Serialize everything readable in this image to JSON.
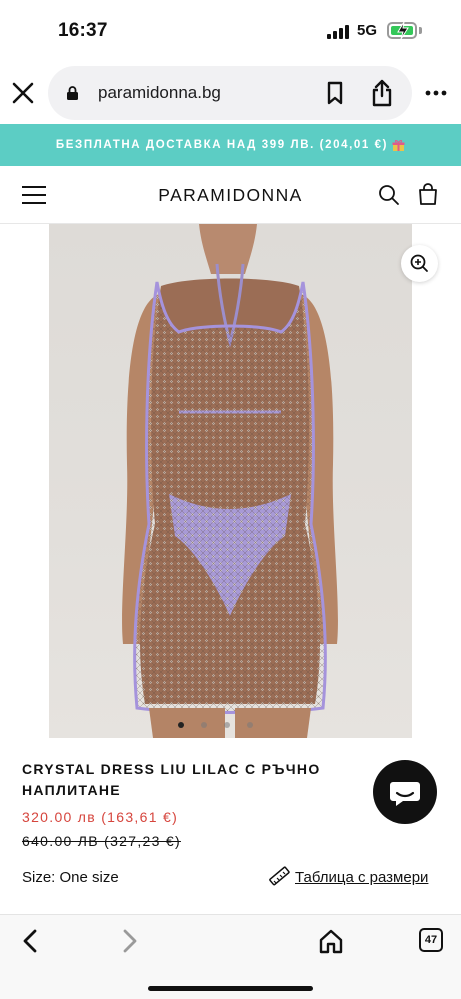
{
  "status_bar": {
    "time": "16:37",
    "network": "5G"
  },
  "browser": {
    "url": "paramidonna.bg"
  },
  "promo": {
    "text": "БЕЗПЛАТНА ДОСТАВКА НАД 399 ЛВ. (204,01 €)"
  },
  "header": {
    "logo": "PARAMIDONNA"
  },
  "product": {
    "title": "CRYSTAL DRESS LIU LILAC С РЪЧНО НАПЛИТАНЕ",
    "price": "320.00 лв (163,61 €)",
    "old_price": "640.00 ЛВ (327,23 €)",
    "size_label": "Size: One size",
    "size_chart_label": "Таблица с размери",
    "gallery": {
      "image_count": 4,
      "active_index": 0
    }
  },
  "toolbar": {
    "tab_count": "47"
  },
  "colors": {
    "accent_teal": "#5ccdc4",
    "price_red": "#d6453d",
    "battery_green": "#34c759"
  }
}
